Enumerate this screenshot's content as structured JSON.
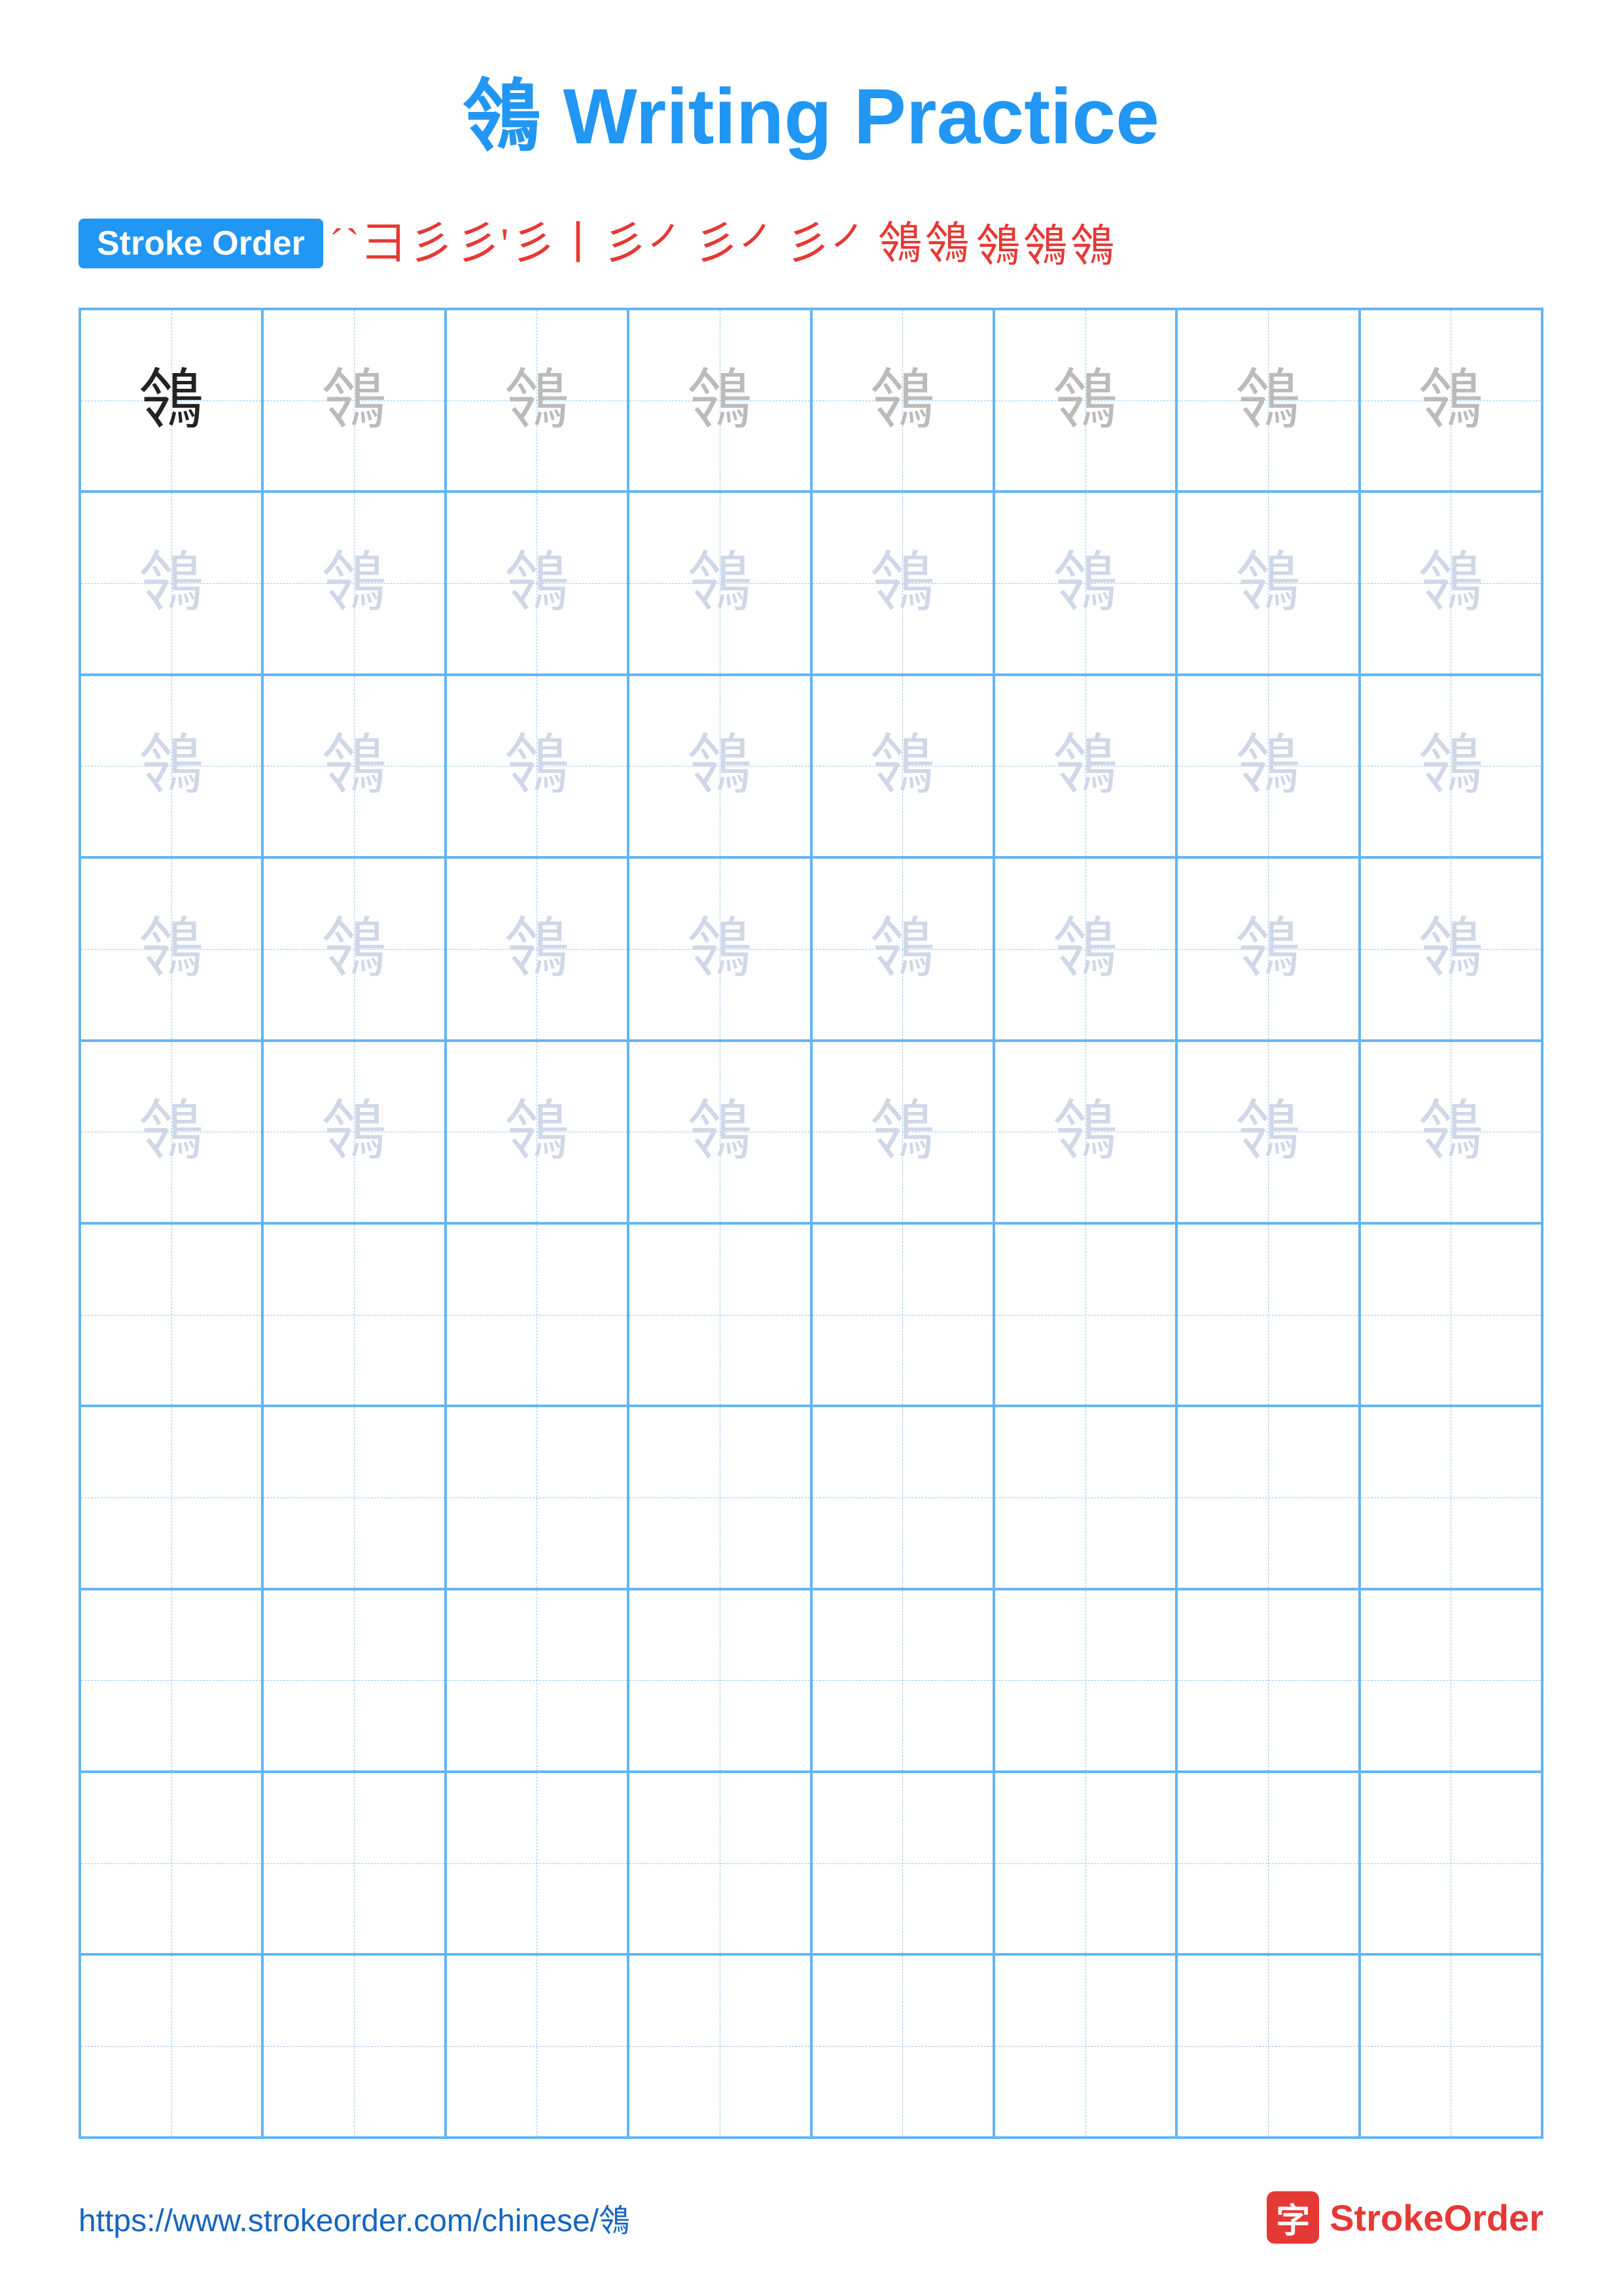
{
  "title": {
    "char": "鴒",
    "text": " Writing Practice"
  },
  "stroke_order": {
    "badge_label": "Stroke Order",
    "strokes_row1": [
      "㇀",
      "㇀",
      "彐",
      "彡",
      "彡'",
      "彡丨",
      "彡㇒",
      "彡㇒",
      "彡㇒鴒",
      "鴒",
      "鴒"
    ],
    "strokes_row2": [
      "鴒",
      "鴒",
      "鴒"
    ],
    "stroke_chars_row1": [
      "ˊ",
      "ˋ",
      "彐",
      "彡",
      "彡'",
      "彡丨",
      "彡㇒",
      "彡㇒",
      "彡㇒",
      "鴒",
      "鴒"
    ],
    "stroke_chars_row2": [
      "鴒",
      "鴒",
      "鴒"
    ]
  },
  "grid": {
    "char": "鴒",
    "rows": 10,
    "cols": 8,
    "filled_rows": 5,
    "practice_char": "鴒"
  },
  "footer": {
    "url": "https://www.strokeorder.com/chinese/鴒",
    "logo_char": "字",
    "logo_text": "StrokeOrder"
  }
}
